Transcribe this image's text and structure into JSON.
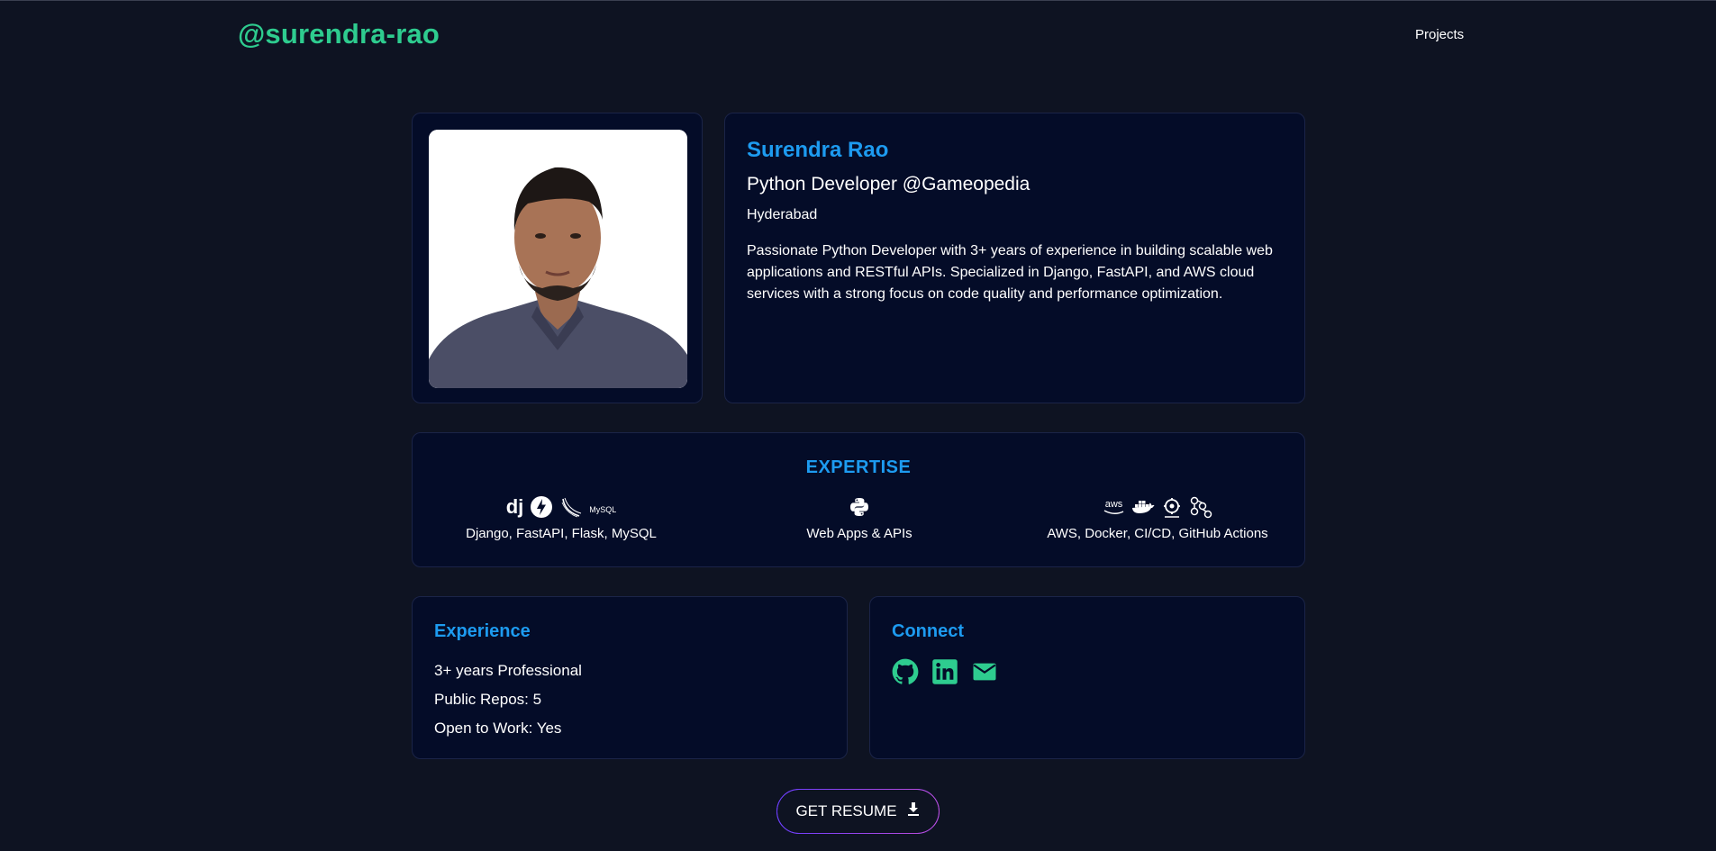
{
  "header": {
    "brand": "@surendra-rao",
    "nav": [
      {
        "label": "Projects"
      }
    ]
  },
  "profile": {
    "name": "Surendra Rao",
    "role": "Python Developer @Gameopedia",
    "location": "Hyderabad",
    "bio": "Passionate Python Developer with 3+ years of experience in building scalable web applications and RESTful APIs. Specialized in Django, FastAPI, and AWS cloud services with a strong focus on code quality and performance optimization."
  },
  "expertise": {
    "title": "EXPERTISE",
    "columns": [
      {
        "label": "Django, FastAPI, Flask, MySQL",
        "icons": [
          "django-icon",
          "fastapi-icon",
          "flask-icon",
          "mysql-icon"
        ],
        "icon_text": {
          "django": "dj",
          "mysql": "MySQL"
        }
      },
      {
        "label": "Web Apps & APIs",
        "icons": [
          "python-icon"
        ]
      },
      {
        "label": "AWS, Docker, CI/CD, GitHub Actions",
        "icons": [
          "aws-icon",
          "docker-icon",
          "cicd-icon",
          "github-actions-icon"
        ],
        "icon_text": {
          "aws": "aws"
        }
      }
    ]
  },
  "experience": {
    "title": "Experience",
    "facts": [
      "3+ years Professional",
      "Public Repos: 5",
      "Open to Work: Yes"
    ]
  },
  "connect": {
    "title": "Connect",
    "links": [
      "github-icon",
      "linkedin-icon",
      "email-icon"
    ]
  },
  "resume_button": {
    "label": "GET RESUME",
    "icon": "download-icon"
  },
  "colors": {
    "background": "#0e1322",
    "card": "#040c28",
    "accent_blue": "#1d9bf0",
    "accent_green": "#2ecc8f"
  }
}
